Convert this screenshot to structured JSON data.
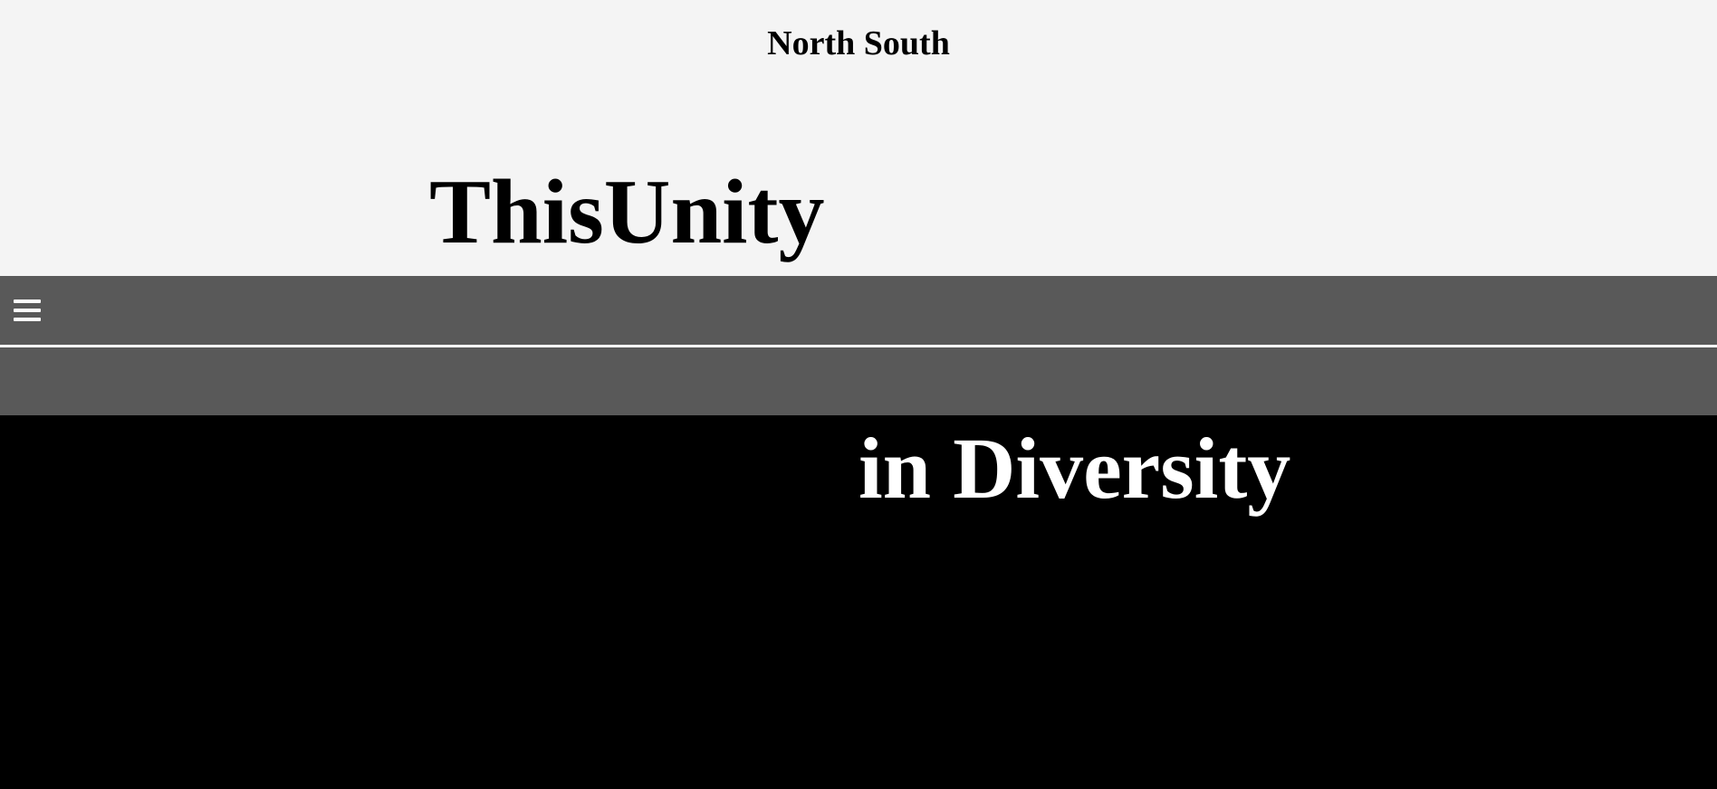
{
  "header": {
    "site_name": "North South",
    "background_color": "#f4f4f4"
  },
  "hero": {
    "line_top": "ThisUnity",
    "line_bottom": "in Diversity"
  },
  "nav": {
    "menu_icon": "hamburger-menu-icon",
    "background_color": "#595959"
  },
  "colors": {
    "dark_background": "#000000",
    "nav_background": "#595959",
    "light_background": "#f4f4f4",
    "divider": "#ffffff"
  }
}
